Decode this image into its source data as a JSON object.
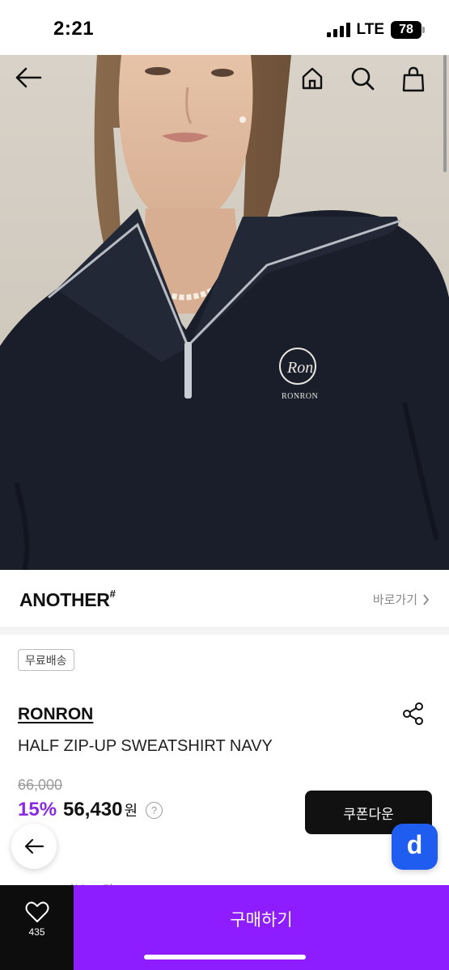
{
  "status_bar": {
    "time": "2:21",
    "network": "LTE",
    "battery": "78"
  },
  "hero": {
    "icons": [
      "back-arrow-icon",
      "home-icon",
      "search-icon",
      "shopping-bag-icon"
    ],
    "logo_text": "RONRON",
    "monogram": "Ron"
  },
  "brand": {
    "name": "ANOTHER",
    "mark": "#",
    "link_label": "바로가기"
  },
  "badge": {
    "label": "무료배송"
  },
  "product": {
    "brand": "RONRON",
    "name": "HALF ZIP-UP SWEATSHIRT NAVY"
  },
  "price": {
    "original": "66,000",
    "discount": "15%",
    "sale": "56,430",
    "currency": "원",
    "info": "?"
  },
  "coupon_button": {
    "label": "쿠폰다운"
  },
  "floating": {
    "back_icon": "back-arrow-icon",
    "app_badge": "d"
  },
  "review_peek": {
    "text": "★ 4.5 · 리뷰 33건"
  },
  "bottom_bar": {
    "like_count": "435",
    "buy_label": "구매하기"
  },
  "colors": {
    "accent_purple": "#8d1cff",
    "discount_purple": "#8a2be2",
    "dark": "#0d0d0d",
    "app_blue": "#1f5cf0"
  }
}
